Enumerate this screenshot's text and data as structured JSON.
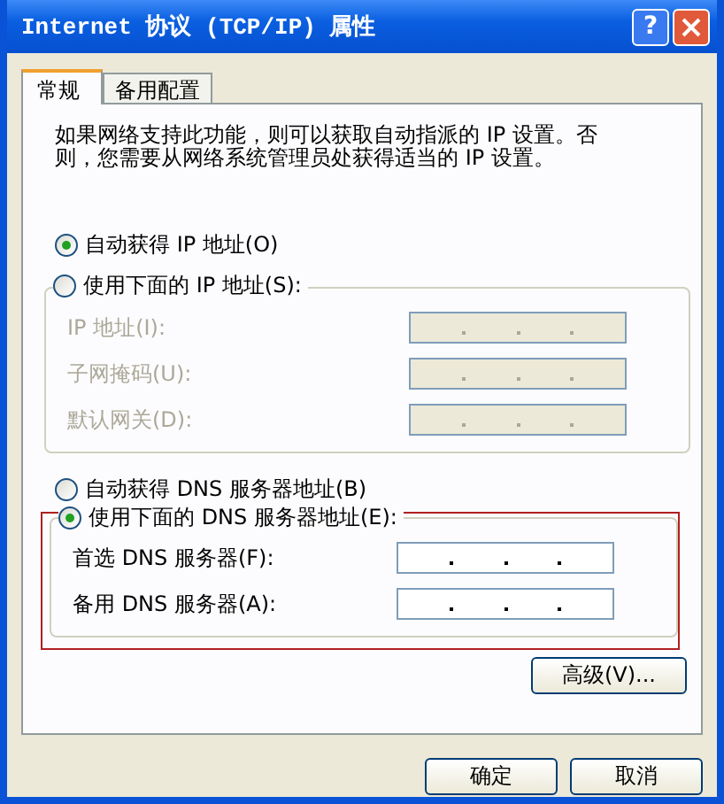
{
  "window": {
    "title": "Internet 协议 (TCP/IP) 属性",
    "help_glyph": "?"
  },
  "tabs": [
    {
      "label": "常规",
      "selected": true
    },
    {
      "label": "备用配置",
      "selected": false
    }
  ],
  "description": "如果网络支持此功能，则可以获取自动指派的 IP 设置。否则，您需要从网络系统管理员处获得适当的 IP 设置。",
  "ip_mode": [
    {
      "label": "自动获得 IP 地址(O)",
      "selected": true
    },
    {
      "label": "使用下面的 IP 地址(S):",
      "selected": false
    }
  ],
  "ip_fields": [
    {
      "label": "IP 地址(I):",
      "disabled": true
    },
    {
      "label": "子网掩码(U):",
      "disabled": true
    },
    {
      "label": "默认网关(D):",
      "disabled": true
    }
  ],
  "dns_mode": [
    {
      "label": "自动获得 DNS 服务器地址(B)",
      "selected": false
    },
    {
      "label": "使用下面的 DNS 服务器地址(E):",
      "selected": true
    }
  ],
  "dns_fields": [
    {
      "label": "首选 DNS 服务器(F):",
      "disabled": false
    },
    {
      "label": "备用 DNS 服务器(A):",
      "disabled": false
    }
  ],
  "dns_highlighted": true,
  "advanced_button": "高级(V)...",
  "buttons": [
    "确定",
    "取消"
  ]
}
